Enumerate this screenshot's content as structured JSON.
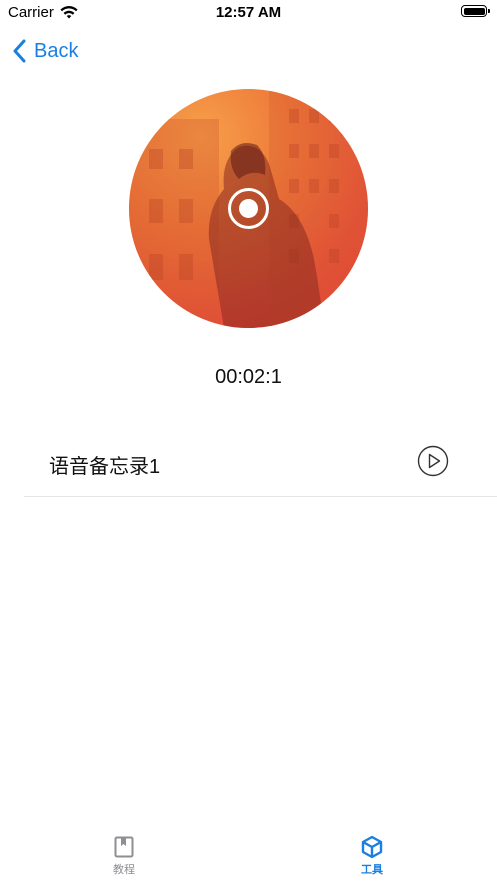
{
  "status_bar": {
    "carrier": "Carrier",
    "time": "12:57 AM",
    "wifi_icon": "wifi-icon",
    "battery_icon": "battery-icon"
  },
  "nav": {
    "back_label": "Back",
    "back_icon": "chevron-left-icon"
  },
  "recorder": {
    "elapsed": "00:02:1",
    "record_icon": "record-icon",
    "disc_colors": [
      "#f6a04a",
      "#e23c35"
    ]
  },
  "memos": [
    {
      "title": "语音备忘录1",
      "play_icon": "play-circle-icon"
    }
  ],
  "tab_bar": {
    "tabs": [
      {
        "label": "教程",
        "icon": "book-icon",
        "selected": false
      },
      {
        "label": "工具",
        "icon": "cube-icon",
        "selected": true
      }
    ]
  },
  "colors": {
    "accent": "#1a7fe0",
    "inactive": "#8e8e93",
    "divider": "#e4e4e4"
  }
}
